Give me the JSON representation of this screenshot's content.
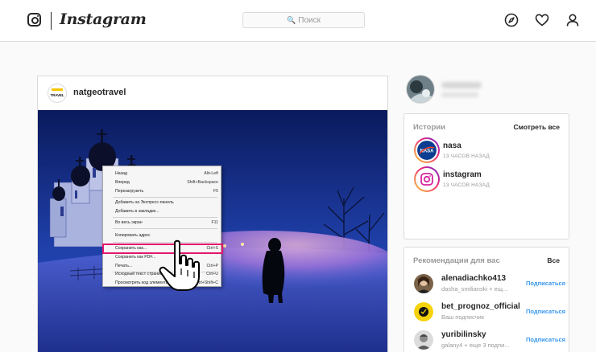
{
  "nav": {
    "wordmark": "Instagram",
    "search_placeholder": "Поиск",
    "icons": [
      "instagram-logo-icon",
      "compass-icon",
      "heart-icon",
      "profile-icon"
    ]
  },
  "post": {
    "username": "natgeotravel",
    "avatar_brand": "TRAVEL"
  },
  "context_menu": {
    "items": [
      {
        "label": "Назад",
        "shortcut": "Alt+Left"
      },
      {
        "label": "Вперед",
        "shortcut": "Shift+Backspace"
      },
      {
        "label": "Перезагрузить",
        "shortcut": "F5"
      },
      {
        "label": "Добавить на Экспресс-панель",
        "shortcut": ""
      },
      {
        "label": "Добавить в закладки...",
        "shortcut": ""
      },
      {
        "label": "Во весь экран",
        "shortcut": "F11"
      },
      {
        "label": "Копировать адрес",
        "shortcut": ""
      },
      {
        "label": "Сохранить как...",
        "shortcut": "Ctrl+S"
      },
      {
        "label": "Сохранить как PDF...",
        "shortcut": ""
      },
      {
        "label": "Печать...",
        "shortcut": "Ctrl+P"
      },
      {
        "label": "Исходный текст страницы",
        "shortcut": "Ctrl+U"
      },
      {
        "label": "Просмотреть код элемента",
        "shortcut": "Ctrl+Shift+C"
      }
    ],
    "highlighted_item": "Сохранить как..."
  },
  "stories": {
    "title": "Истории",
    "action": "Смотреть все",
    "items": [
      {
        "name": "nasa",
        "time": "13 ЧАСОВ НАЗАД"
      },
      {
        "name": "instagram",
        "time": "13 ЧАСОВ НАЗАД"
      }
    ]
  },
  "recommendations": {
    "title": "Рекомендации для вас",
    "action": "Все",
    "follow_label": "Подписаться",
    "items": [
      {
        "name": "alenadiachko413",
        "sub": "dasha_smilianski + ещ..."
      },
      {
        "name": "bet_prognoz_official",
        "sub": "Ваш подписчик"
      },
      {
        "name": "yuribilinsky",
        "sub": "galany4 + еще 3 подпи..."
      }
    ]
  },
  "colors": {
    "accent": "#3897f0",
    "highlight": "#e4176c",
    "border": "#dbdbdb"
  }
}
